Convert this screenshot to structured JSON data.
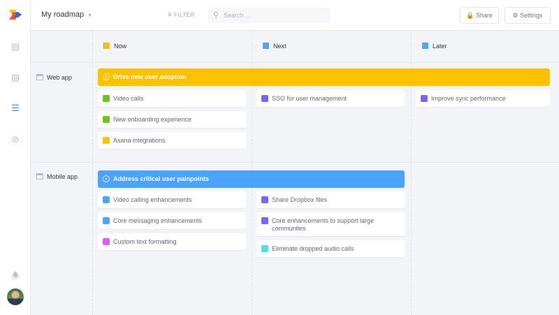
{
  "header": {
    "title": "My roadmap",
    "filter_label": "FILTER",
    "search_placeholder": "Search ...",
    "share_label": "Share",
    "settings_label": "Settings"
  },
  "sidebar": {
    "icons": [
      "roadmap-list-icon",
      "notes-icon",
      "timeline-icon",
      "insights-icon"
    ],
    "active": "timeline-icon"
  },
  "columns": [
    {
      "label": "Now",
      "flag_color": "#ffc107"
    },
    {
      "label": "Next",
      "flag_color": "#4da3ff"
    },
    {
      "label": "Later",
      "flag_color": "#4da3ff"
    }
  ],
  "lanes": [
    {
      "label": "Web app",
      "goal": {
        "label": "Drive new user adoption",
        "color": "#ffc200",
        "span": "Now–Later"
      },
      "cards": [
        [
          {
            "label": "Video calls",
            "color": "#6cc51f"
          },
          {
            "label": "New onboarding experience",
            "color": "#6cc51f"
          },
          {
            "label": "Asana integrations",
            "color": "#ffc107"
          }
        ],
        [
          {
            "label": "SSO for user management",
            "color": "#7b61ff"
          }
        ],
        [
          {
            "label": "Improve sync performance",
            "color": "#7b61ff"
          }
        ]
      ]
    },
    {
      "label": "Mobile app",
      "goal": {
        "label": "Address critical user painpoints",
        "color": "#4aa3ff",
        "span": "Now–Next"
      },
      "cards": [
        [
          {
            "label": "Video calling enhancements",
            "color": "#4aa3ff"
          },
          {
            "label": "Core messaging enhancements",
            "color": "#4aa3ff"
          },
          {
            "label": "Custom text formatting",
            "color": "#e05cf0"
          }
        ],
        [
          {
            "label": "Share Dropbox files",
            "color": "#7b61ff"
          },
          {
            "label": "Core enhancements to support large communites",
            "color": "#7b61ff"
          },
          {
            "label": "Eliminate dropped audio calls",
            "color": "#4fe0e0"
          }
        ],
        []
      ]
    }
  ]
}
